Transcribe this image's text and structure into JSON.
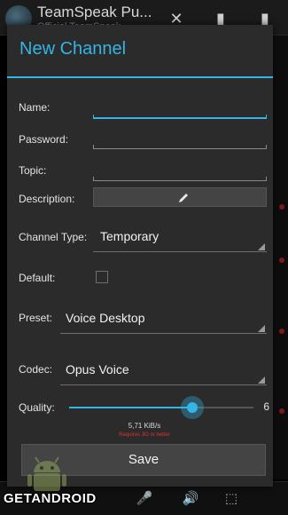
{
  "background_app": {
    "title": "TeamSpeak Pu...",
    "subtitle": "Official TeamSpeak..."
  },
  "dialog": {
    "title": "New Channel",
    "accent_color": "#33b5e5"
  },
  "form": {
    "name_label": "Name:",
    "password_label": "Password:",
    "topic_label": "Topic:",
    "description_label": "Description:",
    "channel_type_label": "Channel Type:",
    "channel_type_value": "Temporary",
    "default_label": "Default:",
    "default_checked": false,
    "preset_label": "Preset:",
    "preset_value": "Voice Desktop",
    "codec_label": "Codec:",
    "codec_value": "Opus Voice",
    "quality_label": "Quality:",
    "quality_value": 4,
    "quality_max": 6,
    "bitrate": "5,71 KiB/s",
    "bitrate_warning": "Requires 3G or better",
    "save_label": "Save"
  },
  "watermark": {
    "text": "GETANDROID"
  },
  "icons": {
    "description_edit": "pencil-icon",
    "bottom_bar": [
      "mic-icon",
      "speaker-icon",
      "bookmark-icon"
    ]
  }
}
